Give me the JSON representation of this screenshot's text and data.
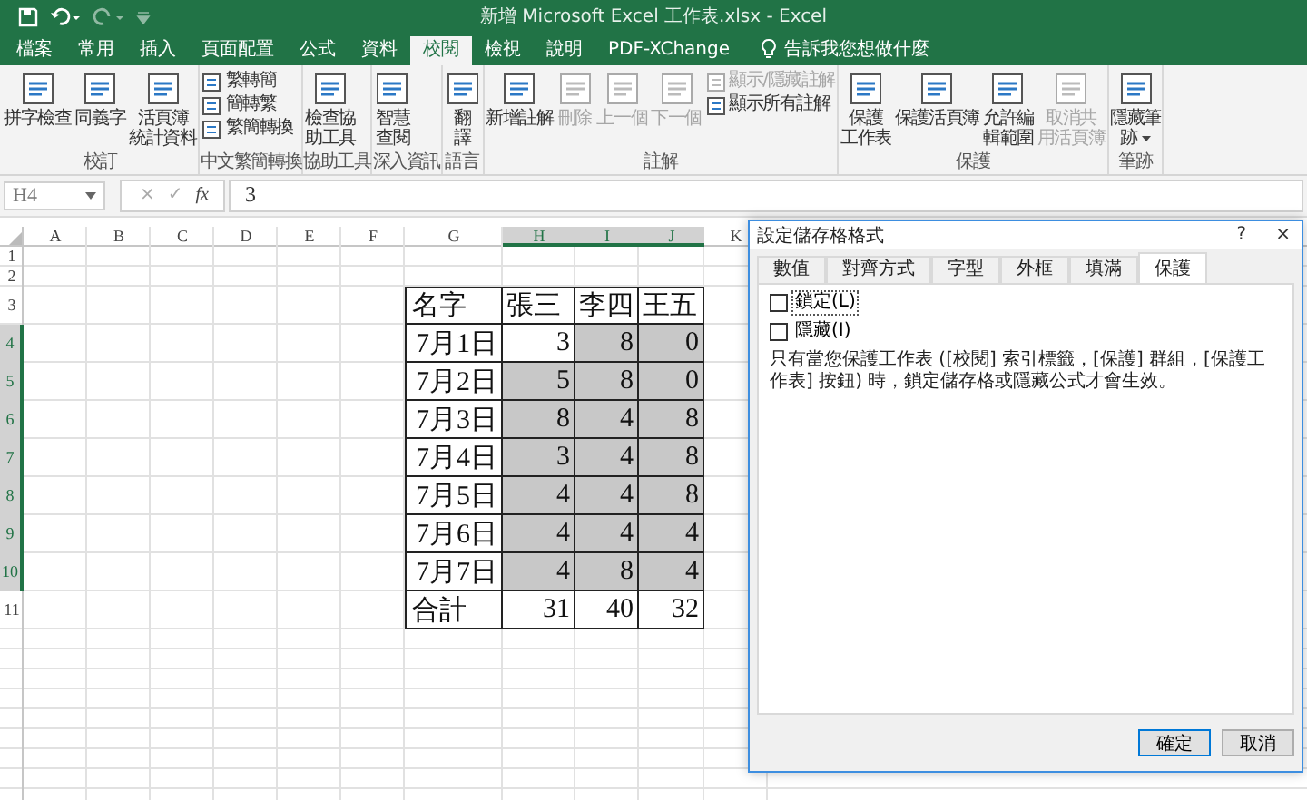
{
  "title_bar": {
    "title": "新增 Microsoft Excel 工作表.xlsx  -  Excel"
  },
  "tabs": [
    {
      "label": "檔案",
      "selected": false
    },
    {
      "label": "常用",
      "selected": false
    },
    {
      "label": "插入",
      "selected": false
    },
    {
      "label": "頁面配置",
      "selected": false
    },
    {
      "label": "公式",
      "selected": false
    },
    {
      "label": "資料",
      "selected": false
    },
    {
      "label": "校閱",
      "selected": true
    },
    {
      "label": "檢視",
      "selected": false
    },
    {
      "label": "說明",
      "selected": false
    },
    {
      "label": "PDF-XChange",
      "selected": false
    }
  ],
  "tell_me": "告訴我您想做什麼",
  "ribbon": [
    {
      "label": "校訂",
      "buttons": [
        {
          "kind": "large",
          "lines": [
            "拼字檢查"
          ],
          "disabled": false
        },
        {
          "kind": "large",
          "lines": [
            "同義字"
          ],
          "disabled": false
        },
        {
          "kind": "large",
          "lines": [
            "活頁簿",
            "統計資料"
          ],
          "disabled": false
        }
      ]
    },
    {
      "label": "中文繁簡轉換",
      "buttons": [
        {
          "kind": "small",
          "label": "繁轉簡",
          "disabled": false
        },
        {
          "kind": "small",
          "label": "簡轉繁",
          "disabled": false
        },
        {
          "kind": "small",
          "label": "繁簡轉換",
          "disabled": false
        }
      ]
    },
    {
      "label": "協助工具",
      "buttons": [
        {
          "kind": "large",
          "lines": [
            "檢查協",
            "助工具"
          ],
          "disabled": false
        }
      ]
    },
    {
      "label": "深入資訊",
      "buttons": [
        {
          "kind": "large",
          "lines": [
            "智慧",
            "查閱"
          ],
          "disabled": false
        }
      ]
    },
    {
      "label": "語言",
      "buttons": [
        {
          "kind": "large",
          "lines": [
            "翻",
            "譯"
          ],
          "disabled": false
        }
      ]
    },
    {
      "label": "註解",
      "buttons": [
        {
          "kind": "large",
          "lines": [
            "新增註解"
          ],
          "disabled": false
        },
        {
          "kind": "large",
          "lines": [
            "刪除"
          ],
          "disabled": true
        },
        {
          "kind": "large",
          "lines": [
            "上一個"
          ],
          "disabled": true
        },
        {
          "kind": "large",
          "lines": [
            "下一個"
          ],
          "disabled": true
        },
        {
          "kind": "small",
          "label": "顯示/隱藏註解",
          "disabled": true
        },
        {
          "kind": "small",
          "label": "顯示所有註解",
          "disabled": false
        }
      ]
    },
    {
      "label": "保護",
      "buttons": [
        {
          "kind": "large",
          "lines": [
            "保護",
            "工作表"
          ],
          "disabled": false
        },
        {
          "kind": "large",
          "lines": [
            "保護活頁簿"
          ],
          "disabled": false
        },
        {
          "kind": "large",
          "lines": [
            "允許編",
            "輯範圍"
          ],
          "disabled": false
        },
        {
          "kind": "large",
          "lines": [
            "取消共",
            "用活頁簿"
          ],
          "disabled": true
        }
      ]
    },
    {
      "label": "筆跡",
      "buttons": [
        {
          "kind": "large",
          "lines": [
            "隱藏筆",
            "跡"
          ],
          "disabled": false,
          "dropdown": true
        }
      ]
    }
  ],
  "formula_bar": {
    "name_box": "H4",
    "cancel": "×",
    "enter": "✓",
    "fx": "fx",
    "value": "3"
  },
  "sheet": {
    "columns": [
      {
        "label": "A",
        "selected": false
      },
      {
        "label": "B",
        "selected": false
      },
      {
        "label": "C",
        "selected": false
      },
      {
        "label": "D",
        "selected": false
      },
      {
        "label": "E",
        "selected": false
      },
      {
        "label": "F",
        "selected": false
      },
      {
        "label": "G",
        "selected": false
      },
      {
        "label": "H",
        "selected": true
      },
      {
        "label": "I",
        "selected": true
      },
      {
        "label": "J",
        "selected": true
      },
      {
        "label": "K",
        "selected": false
      }
    ],
    "rows": [
      {
        "number": "1",
        "selected": false
      },
      {
        "number": "2",
        "selected": false
      },
      {
        "number": "3",
        "selected": false,
        "kind": "header",
        "cells": [
          {
            "text": "名字",
            "selected": false
          },
          {
            "text": "張三",
            "selected": false
          },
          {
            "text": "李四",
            "selected": false
          },
          {
            "text": "王五",
            "selected": false
          }
        ]
      },
      {
        "number": "4",
        "selected": true,
        "kind": "data",
        "cells": [
          {
            "text": "7月1日",
            "selected": false
          },
          {
            "text": "3",
            "selected": false
          },
          {
            "text": "8",
            "selected": true
          },
          {
            "text": "0",
            "selected": true
          }
        ]
      },
      {
        "number": "5",
        "selected": true,
        "kind": "data",
        "cells": [
          {
            "text": "7月2日",
            "selected": false
          },
          {
            "text": "5",
            "selected": true
          },
          {
            "text": "8",
            "selected": true
          },
          {
            "text": "0",
            "selected": true
          }
        ]
      },
      {
        "number": "6",
        "selected": true,
        "kind": "data",
        "cells": [
          {
            "text": "7月3日",
            "selected": false
          },
          {
            "text": "8",
            "selected": true
          },
          {
            "text": "4",
            "selected": true
          },
          {
            "text": "8",
            "selected": true
          }
        ]
      },
      {
        "number": "7",
        "selected": true,
        "kind": "data",
        "cells": [
          {
            "text": "7月4日",
            "selected": false
          },
          {
            "text": "3",
            "selected": true
          },
          {
            "text": "4",
            "selected": true
          },
          {
            "text": "8",
            "selected": true
          }
        ]
      },
      {
        "number": "8",
        "selected": true,
        "kind": "data",
        "cells": [
          {
            "text": "7月5日",
            "selected": false
          },
          {
            "text": "4",
            "selected": true
          },
          {
            "text": "4",
            "selected": true
          },
          {
            "text": "8",
            "selected": true
          }
        ]
      },
      {
        "number": "9",
        "selected": true,
        "kind": "data",
        "cells": [
          {
            "text": "7月6日",
            "selected": false
          },
          {
            "text": "4",
            "selected": true
          },
          {
            "text": "4",
            "selected": true
          },
          {
            "text": "4",
            "selected": true
          }
        ]
      },
      {
        "number": "10",
        "selected": true,
        "kind": "data",
        "cells": [
          {
            "text": "7月7日",
            "selected": false
          },
          {
            "text": "4",
            "selected": true
          },
          {
            "text": "8",
            "selected": true
          },
          {
            "text": "4",
            "selected": true
          }
        ]
      },
      {
        "number": "11",
        "selected": false,
        "kind": "total",
        "cells": [
          {
            "text": "合計",
            "selected": false
          },
          {
            "text": "31",
            "selected": false
          },
          {
            "text": "40",
            "selected": false
          },
          {
            "text": "32",
            "selected": false
          }
        ]
      }
    ]
  },
  "dialog": {
    "title": "設定儲存格格式",
    "help": "?",
    "close": "×",
    "tabs": [
      {
        "label": "數值",
        "selected": false
      },
      {
        "label": "對齊方式",
        "selected": false
      },
      {
        "label": "字型",
        "selected": false
      },
      {
        "label": "外框",
        "selected": false
      },
      {
        "label": "填滿",
        "selected": false
      },
      {
        "label": "保護",
        "selected": true
      }
    ],
    "checkboxes": [
      {
        "label": "鎖定(L)",
        "checked": false
      },
      {
        "label": "隱藏(I)",
        "checked": false
      }
    ],
    "note": "只有當您保護工作表 ([校閱] 索引標籤，[保護] 群組，[保護工作表] 按鈕) 時，鎖定儲存格或隱藏公式才會生效。",
    "buttons": [
      {
        "label": "確定",
        "kind": "primary"
      },
      {
        "label": "取消",
        "kind": "normal"
      }
    ]
  }
}
